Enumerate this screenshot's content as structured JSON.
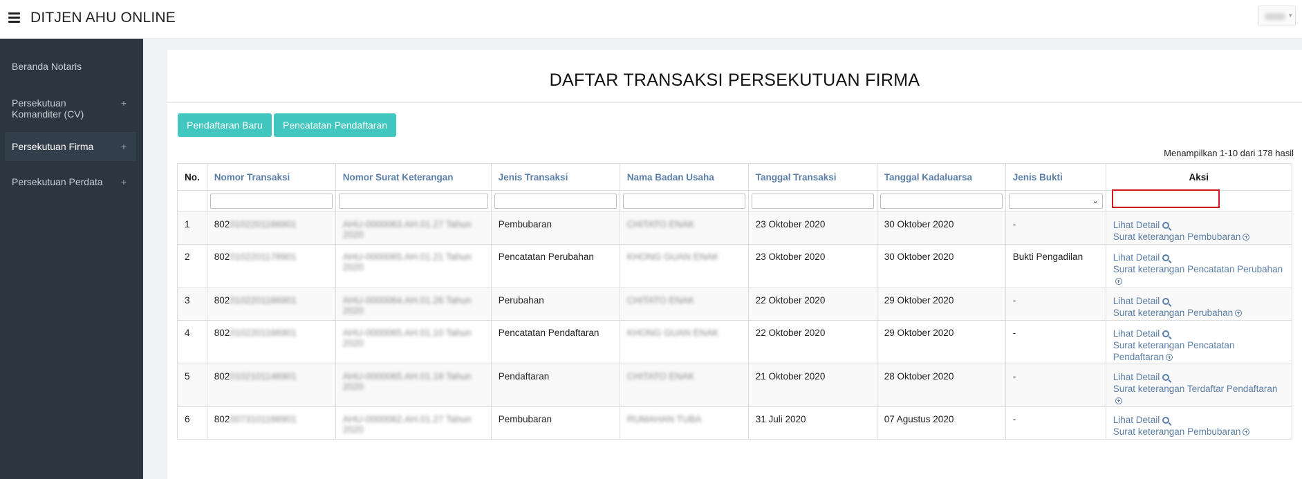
{
  "header": {
    "title": "DITJEN AHU ONLINE",
    "user": ""
  },
  "sidebar": {
    "items": [
      {
        "label": "Beranda Notaris",
        "plus": ""
      },
      {
        "label": "Persekutuan Komanditer (CV)",
        "plus": "+"
      },
      {
        "label": "Persekutuan Firma",
        "plus": "+"
      },
      {
        "label": "Persekutuan Perdata",
        "plus": "+"
      }
    ]
  },
  "main": {
    "title": "DAFTAR TRANSAKSI PERSEKUTUAN FIRMA",
    "buttons": {
      "new": "Pendaftaran Baru",
      "record": "Pencatatan Pendaftaran"
    },
    "result_count": "Menampilkan 1-10 dari 178 hasil",
    "columns": [
      "No.",
      "Nomor Transaksi",
      "Nomor Surat Keterangan",
      "Jenis Transaksi",
      "Nama Badan Usaha",
      "Tanggal Transaksi",
      "Tanggal Kadaluarsa",
      "Jenis Bukti",
      "Aksi"
    ],
    "rows": [
      {
        "no": "1",
        "nomor_prefix": "802",
        "nomor_blur": "0102201166901",
        "surat_blur": "AHU-0000063.AH.01.27 Tahun 2020",
        "jenis": "Pembubaran",
        "nama_blur": "CHITATO ENAK",
        "tgl": "23 Oktober 2020",
        "kadaluarsa": "30 Oktober 2020",
        "bukti": "-",
        "detail": "Lihat Detail",
        "surat": "Surat keterangan Pembubaran"
      },
      {
        "no": "2",
        "nomor_prefix": "802",
        "nomor_blur": "0102201178901",
        "surat_blur": "AHU-0000065.AH.01.21 Tahun 2020",
        "jenis": "Pencatatan Perubahan",
        "nama_blur": "KHONG GUAN ENAK",
        "tgl": "23 Oktober 2020",
        "kadaluarsa": "30 Oktober 2020",
        "bukti": "Bukti Pengadilan",
        "detail": "Lihat Detail",
        "surat": "Surat keterangan Pencatatan Perubahan"
      },
      {
        "no": "3",
        "nomor_prefix": "802",
        "nomor_blur": "0102201166901",
        "surat_blur": "AHU-0000064.AH.01.26 Tahun 2020",
        "jenis": "Perubahan",
        "nama_blur": "CHITATO ENAK",
        "tgl": "22 Oktober 2020",
        "kadaluarsa": "29 Oktober 2020",
        "bukti": "-",
        "detail": "Lihat Detail",
        "surat": "Surat keterangan Perubahan"
      },
      {
        "no": "4",
        "nomor_prefix": "802",
        "nomor_blur": "0102201166901",
        "surat_blur": "AHU-0000065.AH.01.10 Tahun 2020",
        "jenis": "Pencatatan Pendaftaran",
        "nama_blur": "KHONG GUAN ENAK",
        "tgl": "22 Oktober 2020",
        "kadaluarsa": "29 Oktober 2020",
        "bukti": "-",
        "detail": "Lihat Detail",
        "surat": "Surat keterangan Pencatatan Pendaftaran"
      },
      {
        "no": "5",
        "nomor_prefix": "802",
        "nomor_blur": "0102101146901",
        "surat_blur": "AHU-0000065.AH.01.18 Tahun 2020",
        "jenis": "Pendaftaran",
        "nama_blur": "CHITATO ENAK",
        "tgl": "21 Oktober 2020",
        "kadaluarsa": "28 Oktober 2020",
        "bukti": "-",
        "detail": "Lihat Detail",
        "surat": "Surat keterangan Terdaftar Pendaftaran"
      },
      {
        "no": "6",
        "nomor_prefix": "802",
        "nomor_blur": "0073101166901",
        "surat_blur": "AHU-0000062.AH.01.27 Tahun 2020",
        "jenis": "Pembubaran",
        "nama_blur": "RUMAHAN TUBA",
        "tgl": "31 Juli 2020",
        "kadaluarsa": "07 Agustus 2020",
        "bukti": "-",
        "detail": "Lihat Detail",
        "surat": "Surat keterangan Pembubaran"
      }
    ]
  },
  "colors": {
    "accent": "#42c6c0",
    "link": "#5b7fa8",
    "sidebar": "#2b3640",
    "highlight": "#d0191c"
  }
}
